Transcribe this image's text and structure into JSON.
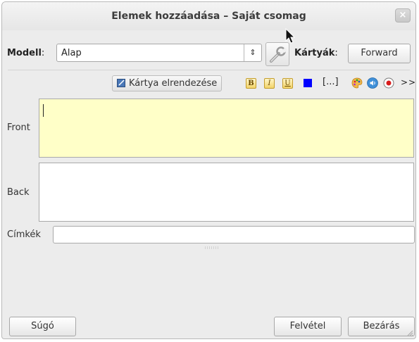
{
  "window": {
    "title": "Elemek hozzáadása – Saját csomag"
  },
  "model": {
    "label": "Modell",
    "colon": ":",
    "value": "Alap"
  },
  "cards": {
    "label": "Kártyák",
    "colon": ":",
    "value": "Forward"
  },
  "toolbar": {
    "layout_label": "Kártya elrendezése",
    "bold": "B",
    "italic": "I",
    "underline": "U",
    "text_color": "#0000ff",
    "cloze": "[...]",
    "more": ">>"
  },
  "fields": [
    {
      "name": "Front",
      "value": ""
    },
    {
      "name": "Back",
      "value": ""
    }
  ],
  "tags": {
    "label": "Címkék",
    "value": ""
  },
  "buttons": {
    "help": "Súgó",
    "add": "Felvétel",
    "close": "Bezárás"
  },
  "colors": {
    "active_field": "#ffffc8",
    "close_x": "#ffffff"
  },
  "icons": [
    "close-icon",
    "wrench-icon",
    "layout-icon",
    "palette-icon",
    "audio-icon",
    "record-icon",
    "mouse-pointer-icon"
  ]
}
